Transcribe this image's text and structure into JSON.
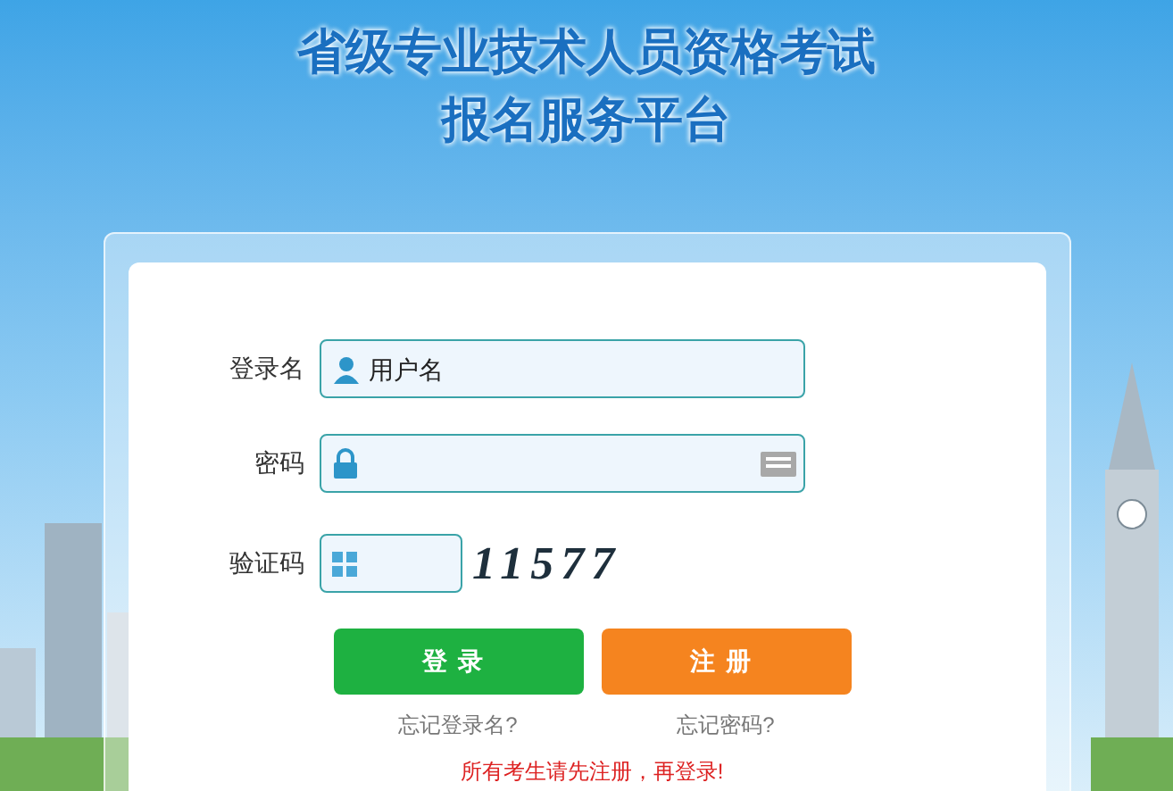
{
  "title_lines": [
    "省级专业技术人员资格考试",
    "报名服务平台"
  ],
  "form": {
    "username_label": "登录名",
    "username_placeholder": "用户名",
    "password_label": "密码",
    "captcha_label": "验证码",
    "captcha_text": "11577"
  },
  "buttons": [
    {
      "label": "登录",
      "kind": "login"
    },
    {
      "label": "注册",
      "kind": "register"
    }
  ],
  "links": [
    "忘记登录名?",
    "忘记密码?"
  ],
  "notice": "所有考生请先注册，再登录!"
}
